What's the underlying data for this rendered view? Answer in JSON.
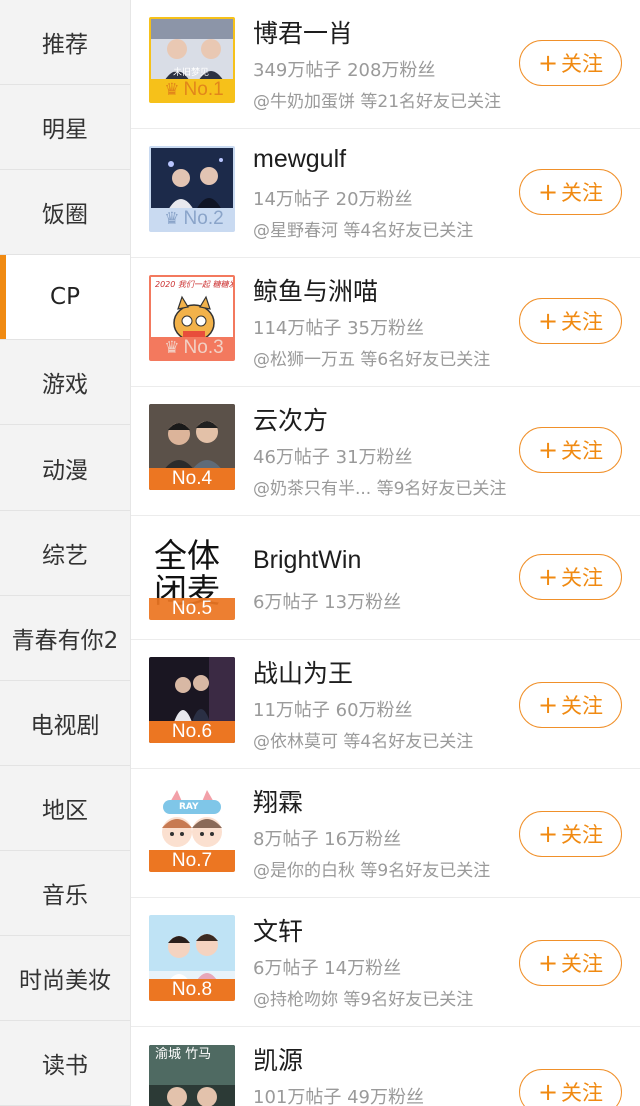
{
  "sidebar": {
    "items": [
      {
        "label": "推荐"
      },
      {
        "label": "明星"
      },
      {
        "label": "饭圈"
      },
      {
        "label": "CP"
      },
      {
        "label": "游戏"
      },
      {
        "label": "动漫"
      },
      {
        "label": "综艺"
      },
      {
        "label": "青春有你2"
      },
      {
        "label": "电视剧"
      },
      {
        "label": "地区"
      },
      {
        "label": "音乐"
      },
      {
        "label": "时尚美妆"
      },
      {
        "label": "读书"
      }
    ],
    "active_index": 3
  },
  "follow_label": "关注",
  "follow_icon": "plus-icon",
  "crown_icon": "crown-icon",
  "accent_color": "#f08a12",
  "list": [
    {
      "rank": "No.1",
      "name": "博君一肖",
      "stats": "349万帖子 208万粉丝",
      "friends": "@牛奶加蛋饼 等21名好友已关注",
      "thumb_text": "未旧梦见"
    },
    {
      "rank": "No.2",
      "name": "mewgulf",
      "stats": "14万帖子 20万粉丝",
      "friends": "@星野春河 等4名好友已关注"
    },
    {
      "rank": "No.3",
      "name": "鲸鱼与洲喵",
      "stats": "114万帖子 35万粉丝",
      "friends": "@松狮一万五 等6名好友已关注",
      "thumb_text": "2020 我们一起 糖糖发"
    },
    {
      "rank": "No.4",
      "name": "云次方",
      "stats": "46万帖子 31万粉丝",
      "friends": "@奶茶只有半... 等9名好友已关注"
    },
    {
      "rank": "No.5",
      "name": "BrightWin",
      "stats": "6万帖子 13万粉丝",
      "friends": "",
      "thumb_text": "全体闭麦"
    },
    {
      "rank": "No.6",
      "name": "战山为王",
      "stats": "11万帖子 60万粉丝",
      "friends": "@依林莫可 等4名好友已关注"
    },
    {
      "rank": "No.7",
      "name": "翔霖",
      "stats": "8万帖子 16万粉丝",
      "friends": "@是你的白秋 等9名好友已关注",
      "thumb_text": "RAY"
    },
    {
      "rank": "No.8",
      "name": "文轩",
      "stats": "6万帖子 14万粉丝",
      "friends": "@持枪吻妳 等9名好友已关注"
    },
    {
      "rank": "",
      "name": "凯源",
      "stats": "101万帖子 49万粉丝",
      "friends": "",
      "thumb_text": "渝城 竹马"
    }
  ]
}
